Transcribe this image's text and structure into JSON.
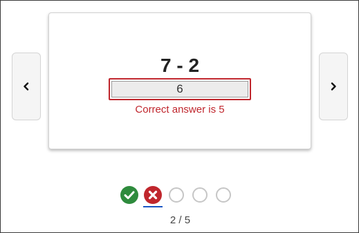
{
  "flashcard": {
    "question": "7 - 2",
    "answer_value": "6",
    "feedback": "Correct answer is 5"
  },
  "navigation": {
    "prev_icon": "chevron-left-icon",
    "next_icon": "chevron-right-icon"
  },
  "progress": {
    "indicators": [
      {
        "state": "correct",
        "icon": "check-circle-icon",
        "color": "#2e8b3d"
      },
      {
        "state": "incorrect",
        "icon": "x-circle-icon",
        "color": "#c0262d",
        "current": true
      },
      {
        "state": "unanswered"
      },
      {
        "state": "unanswered"
      },
      {
        "state": "unanswered"
      }
    ],
    "counter": "2 / 5"
  },
  "colors": {
    "error": "#c0262d",
    "success": "#2e8b3d",
    "active_underline": "#1a56c4"
  }
}
